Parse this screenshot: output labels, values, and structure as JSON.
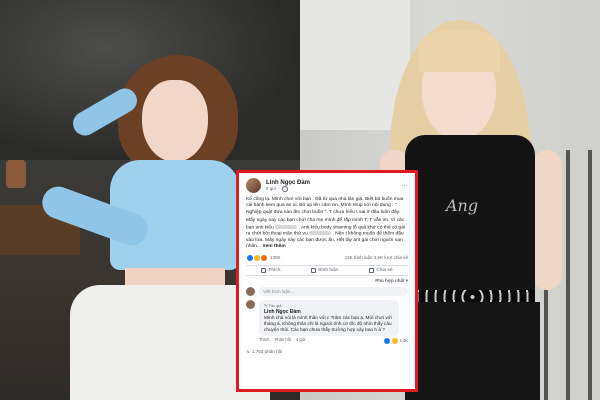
{
  "post": {
    "author": "Linh Ngọc Đàm",
    "time": "5 giờ",
    "paragraph1": "Kể cũng lạ. Mình chơi với bạn . Đã từ qua nhà lân giả. Biết bả buồn mua cái bánh kem qua an ủi. Bỏ up lên cảm ơn. Mình reup với nội dung : \" Nghiệp quật đứa nào ấm chơi buồn \". T chưa hiểu t sai ở đâu luôn đấy.",
    "paragraph2": "Mấy ngày nay các bạn chửi cha mẹ mình để rắp mình T, T vẫn im. Vì các bạn anti kiểu",
    "paragraph2b": ". Anti kiểu body shaming lỗ quá khứ có thể có gái ra chửi bởi thoại mãn thứ vu",
    "paragraph2c": ". Nên t không muốn để thêm dầu vào lửa. Mấy ngày này các bạn được ăn. Hết tây ant gái chửi người nạn nhân...",
    "see_more": "Xem thêm",
    "reaction_count": "130K",
    "comments_count": "12K bình luận",
    "shares_count": "3,6K lượt chia sẻ",
    "actions": {
      "like": "Thích",
      "comment": "Bình luận",
      "share": "Chia sẻ"
    },
    "sort_label": "Phù hợp nhất",
    "comment_placeholder": "Viết bình luận...",
    "comment": {
      "badge": "Tác giả",
      "author": "Linh Ngọc Đàm",
      "text": "Mình chả nói là mình thân với c Trâm các bạn ạ. Mới chơi với tháng á. Không thân chỉ là người tình cờ tốc độ nhìn thấy câu chuyện thôi. Các bạn chưa thấy trường hợp xảy bao h à ?",
      "like": "Thích",
      "reply": "Phản hồi",
      "time": "4 giờ",
      "reacts": "1,4K"
    },
    "views": "1.763 phản hồi"
  }
}
